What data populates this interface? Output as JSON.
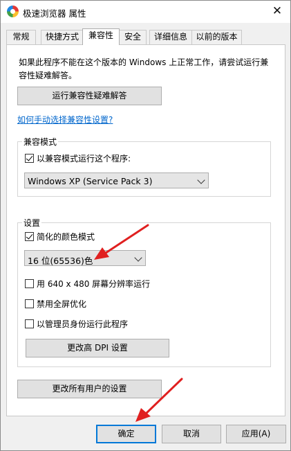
{
  "window": {
    "title": "极速浏览器 属性",
    "close_glyph": "✕"
  },
  "tabs": [
    {
      "label": "常规"
    },
    {
      "label": "快捷方式"
    },
    {
      "label": "兼容性"
    },
    {
      "label": "安全"
    },
    {
      "label": "详细信息"
    },
    {
      "label": "以前的版本"
    }
  ],
  "active_tab": "兼容性",
  "compat": {
    "intro_line1": "如果此程序不能在这个版本的 Windows 上正常工作，请尝试运行兼",
    "intro_line2": "容性疑难解答。",
    "troubleshoot_button": "运行兼容性疑难解答",
    "manual_link": "如何手动选择兼容性设置?",
    "mode_group": {
      "label": "兼容模式",
      "checkbox_label": "以兼容模式运行这个程序:",
      "checked": true,
      "select_value": "Windows XP (Service Pack 3)"
    },
    "settings_group": {
      "label": "设置",
      "reduced_color": {
        "label": "简化的颜色模式",
        "checked": true
      },
      "color_select_value": "16 位(65536)色",
      "res_640": {
        "label": "用 640 x 480 屏幕分辨率运行",
        "checked": false
      },
      "disable_fullscreen": {
        "label": "禁用全屏优化",
        "checked": false
      },
      "run_as_admin": {
        "label": "以管理员身份运行此程序",
        "checked": false
      },
      "dpi_button": "更改高 DPI 设置"
    },
    "all_users_button": "更改所有用户的设置"
  },
  "footer": {
    "ok": "确定",
    "cancel": "取消",
    "apply": "应用(A)"
  },
  "colors": {
    "accent": "#0078d7",
    "link": "#0066cc",
    "annotation_arrow": "#e02020"
  }
}
